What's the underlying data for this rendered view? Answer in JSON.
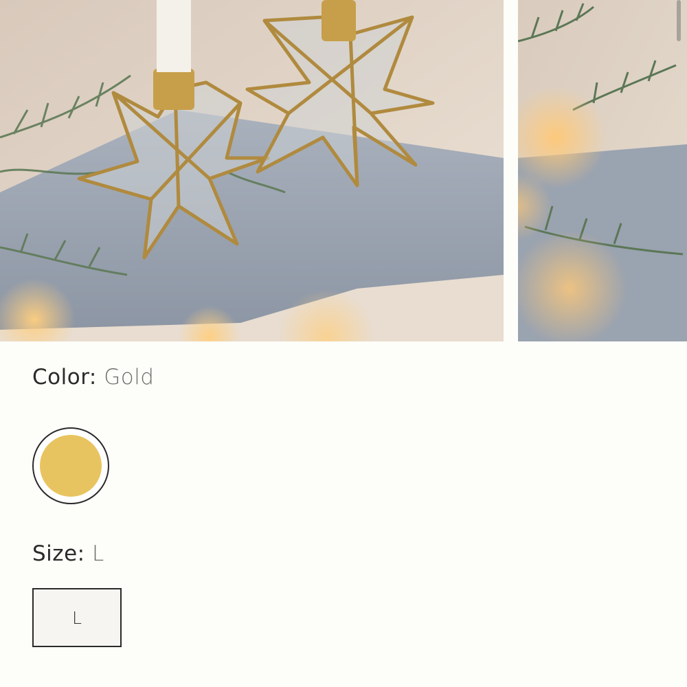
{
  "gallery": {
    "images": [
      {
        "name": "star-candle-holders-photo"
      },
      {
        "name": "star-candle-holder-closeup-photo"
      }
    ]
  },
  "color_option": {
    "label": "Color:",
    "selected": "Gold",
    "swatch_color": "#e8c460"
  },
  "size_option": {
    "label": "Size:",
    "selected": "L",
    "buttons": [
      "L"
    ]
  }
}
